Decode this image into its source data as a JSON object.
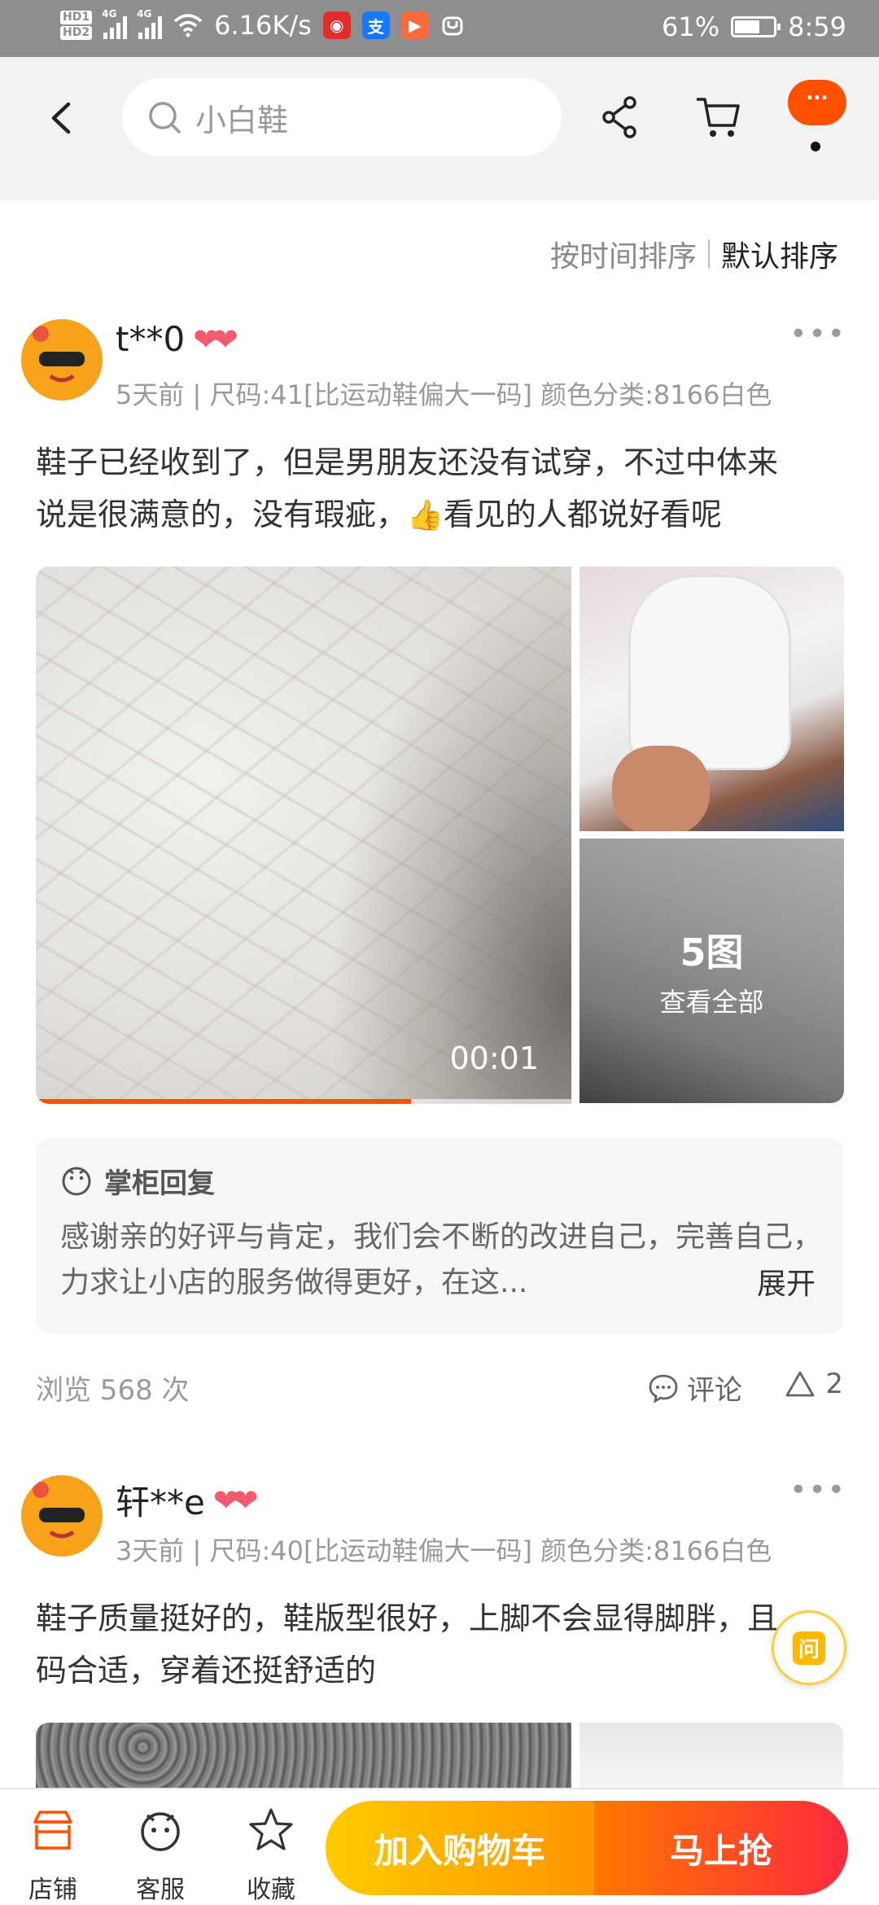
{
  "status_bar": {
    "network_speed": "6.16K/s",
    "battery": "61%",
    "time": "8:59",
    "signal_type_1": "4G",
    "signal_type_2": "4G",
    "hd_1": "HD1",
    "hd_2": "HD2"
  },
  "header": {
    "search_text": "小白鞋",
    "message_badge": "···"
  },
  "sort": {
    "by_time": "按时间排序",
    "default": "默认排序"
  },
  "reviews": [
    {
      "user": "t**0",
      "meta": "5天前 | 尺码:41[比运动鞋偏大一码] 颜色分类:8166白色",
      "text_line1": "鞋子已经收到了，但是男朋友还没有试穿，不过中体来",
      "text_line2_a": "说是很满意的，没有瑕疵，",
      "text_line2_b": "看见的人都说好看呢",
      "video_time": "00:01",
      "video_progress": 0.7,
      "image_count": "5图",
      "view_all": "查看全部",
      "reply_title": "掌柜回复",
      "reply_text": "感谢亲的好评与肯定，我们会不断的改进自己，完善自己，力求让小店的服务做得更好，在这...",
      "reply_expand": "展开",
      "views": "浏览 568 次",
      "comment_label": "评论",
      "likes": "2"
    },
    {
      "user": "轩**e",
      "meta": "3天前 | 尺码:40[比运动鞋偏大一码] 颜色分类:8166白色",
      "text_line1": "鞋子质量挺好的，鞋版型很好，上脚不会显得脚胖，且",
      "text_line2": "码合适，穿着还挺舒适的"
    }
  ],
  "floating": {
    "ask_label": "问"
  },
  "bottom_bar": {
    "store": "店铺",
    "service": "客服",
    "favorite": "收藏",
    "add_cart": "加入购物车",
    "buy_now": "马上抢"
  },
  "colors": {
    "brand_orange": "#ff5000",
    "cart_yellow": "#ffcb00",
    "buy_red": "#ff2a3f"
  }
}
